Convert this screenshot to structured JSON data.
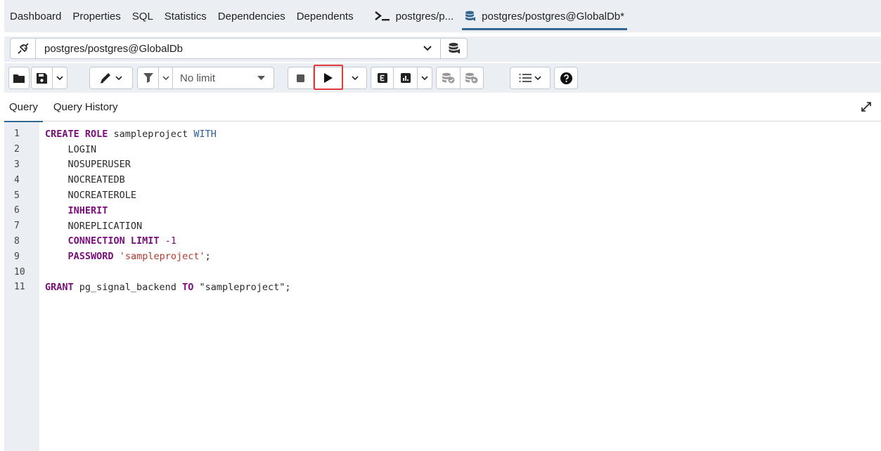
{
  "tabs": [
    {
      "label": "Dashboard"
    },
    {
      "label": "Properties"
    },
    {
      "label": "SQL"
    },
    {
      "label": "Statistics"
    },
    {
      "label": "Dependencies"
    },
    {
      "label": "Dependents"
    },
    {
      "label": "postgres/p..."
    },
    {
      "label": "postgres/postgres@GlobalDb*"
    }
  ],
  "connection": {
    "label": "postgres/postgres@GlobalDb"
  },
  "toolbar": {
    "limit_label": "No limit"
  },
  "subtabs": [
    {
      "label": "Query"
    },
    {
      "label": "Query History"
    }
  ],
  "editor": {
    "lines": [
      {
        "n": "1",
        "tokens": [
          {
            "t": "CREATE ROLE",
            "c": "kw"
          },
          {
            "t": " sampleproject ",
            "c": ""
          },
          {
            "t": "WITH",
            "c": "kwb"
          }
        ]
      },
      {
        "n": "2",
        "tokens": [
          {
            "t": "    LOGIN",
            "c": ""
          }
        ]
      },
      {
        "n": "3",
        "tokens": [
          {
            "t": "    NOSUPERUSER",
            "c": ""
          }
        ]
      },
      {
        "n": "4",
        "tokens": [
          {
            "t": "    NOCREATEDB",
            "c": ""
          }
        ]
      },
      {
        "n": "5",
        "tokens": [
          {
            "t": "    NOCREATEROLE",
            "c": ""
          }
        ]
      },
      {
        "n": "6",
        "tokens": [
          {
            "t": "    ",
            "c": ""
          },
          {
            "t": "INHERIT",
            "c": "kw"
          }
        ]
      },
      {
        "n": "7",
        "tokens": [
          {
            "t": "    NOREPLICATION",
            "c": ""
          }
        ]
      },
      {
        "n": "8",
        "tokens": [
          {
            "t": "    ",
            "c": ""
          },
          {
            "t": "CONNECTION LIMIT",
            "c": "kw"
          },
          {
            "t": " ",
            "c": ""
          },
          {
            "t": "-1",
            "c": "num"
          }
        ]
      },
      {
        "n": "9",
        "tokens": [
          {
            "t": "    ",
            "c": ""
          },
          {
            "t": "PASSWORD",
            "c": "kw"
          },
          {
            "t": " ",
            "c": ""
          },
          {
            "t": "'sampleproject'",
            "c": "str"
          },
          {
            "t": ";",
            "c": ""
          }
        ]
      },
      {
        "n": "10",
        "tokens": []
      },
      {
        "n": "11",
        "tokens": [
          {
            "t": "GRANT",
            "c": "kw"
          },
          {
            "t": " pg_signal_backend ",
            "c": ""
          },
          {
            "t": "TO",
            "c": "kw"
          },
          {
            "t": " \"sampleproject\";",
            "c": "dq"
          }
        ]
      }
    ]
  },
  "colors": {
    "accent": "#326690",
    "highlight": "#e0393b",
    "keyword": "#7a0d7a",
    "keyword_blue": "#2b5ea0",
    "string": "#b03a2e"
  },
  "icons": [
    "terminal-icon",
    "database-icon",
    "plug-icon",
    "chevron-down-icon",
    "folder-icon",
    "save-icon",
    "edit-icon",
    "filter-icon",
    "stop-icon",
    "play-icon",
    "explain-icon",
    "explain-analyze-icon",
    "commit-icon",
    "rollback-icon",
    "macros-icon",
    "help-icon",
    "expand-icon"
  ]
}
